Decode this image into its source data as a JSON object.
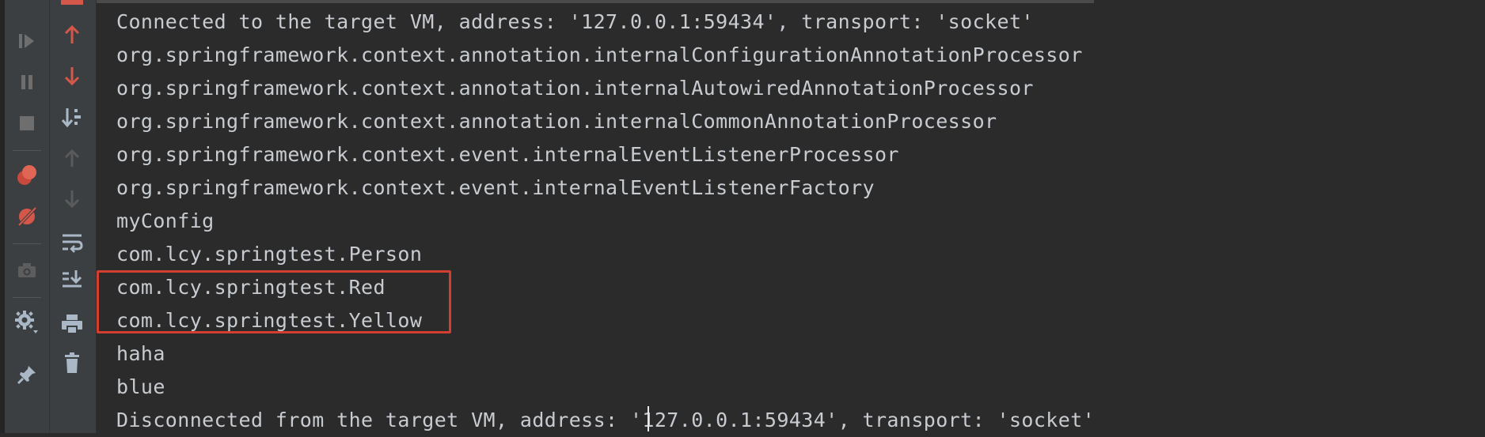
{
  "console": {
    "lines": [
      "Connected to the target VM, address: '127.0.0.1:59434', transport: 'socket'",
      "org.springframework.context.annotation.internalConfigurationAnnotationProcessor",
      "org.springframework.context.annotation.internalAutowiredAnnotationProcessor",
      "org.springframework.context.annotation.internalCommonAnnotationProcessor",
      "org.springframework.context.event.internalEventListenerProcessor",
      "org.springframework.context.event.internalEventListenerFactory",
      "myConfig",
      "com.lcy.springtest.Person",
      "com.lcy.springtest.Red",
      "com.lcy.springtest.Yellow",
      "haha",
      "blue",
      "Disconnected from the target VM, address: '127.0.0.1:59434', transport: 'socket'"
    ],
    "highlighted_lines": [
      "com.lcy.springtest.Red",
      "com.lcy.springtest.Yellow"
    ]
  },
  "toolbar_left": {
    "icons": [
      "resume-program-icon",
      "pause-program-icon",
      "stop-icon",
      "view-breakpoints-icon",
      "mute-breakpoints-icon",
      "camera-icon",
      "settings-icon",
      "pin-icon"
    ]
  },
  "toolbar_right": {
    "icons": [
      "up-arrow-icon",
      "down-arrow-icon",
      "sort-icon",
      "scroll-up-icon",
      "scroll-down-icon",
      "soft-wrap-icon",
      "scroll-to-end-icon",
      "print-icon",
      "trash-icon"
    ]
  },
  "colors": {
    "background": "#2b2b2b",
    "toolbar": "#3c3f41",
    "text": "#c8ccd0",
    "accent_red": "#d23f31"
  }
}
